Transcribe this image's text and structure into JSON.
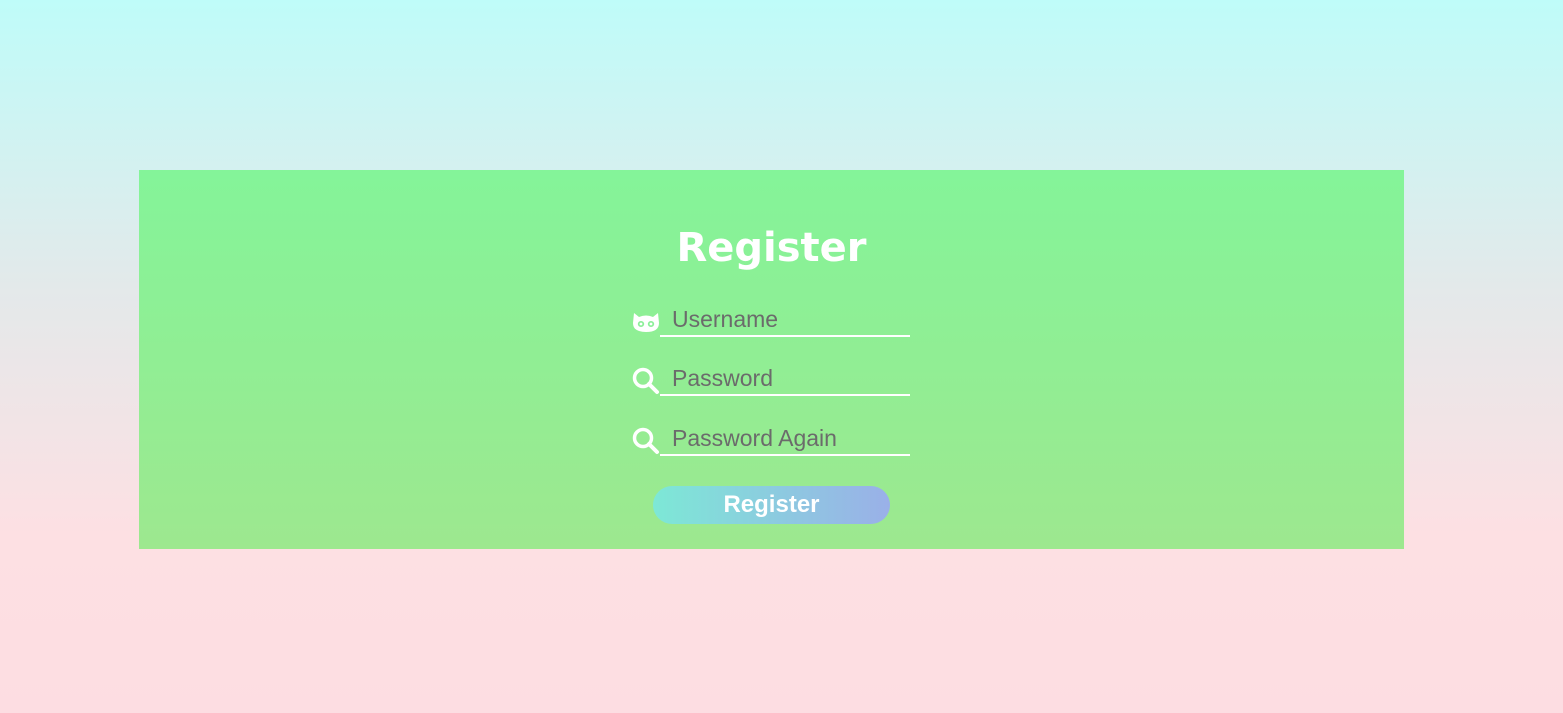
{
  "form": {
    "title": "Register",
    "fields": [
      {
        "placeholder": "Username",
        "icon": "cat-icon",
        "value": ""
      },
      {
        "placeholder": "Password",
        "icon": "magnifier-icon",
        "value": ""
      },
      {
        "placeholder": "Password Again",
        "icon": "magnifier-icon",
        "value": ""
      }
    ],
    "submit_label": "Register"
  },
  "colors": {
    "background_top": "#bffcf9",
    "background_bottom": "#fddde2",
    "panel_top": "#84f499",
    "panel_bottom": "#9de88f",
    "button_left": "#7de8d6",
    "button_right": "#9ab0e8",
    "accent_white": "#ffffff"
  }
}
